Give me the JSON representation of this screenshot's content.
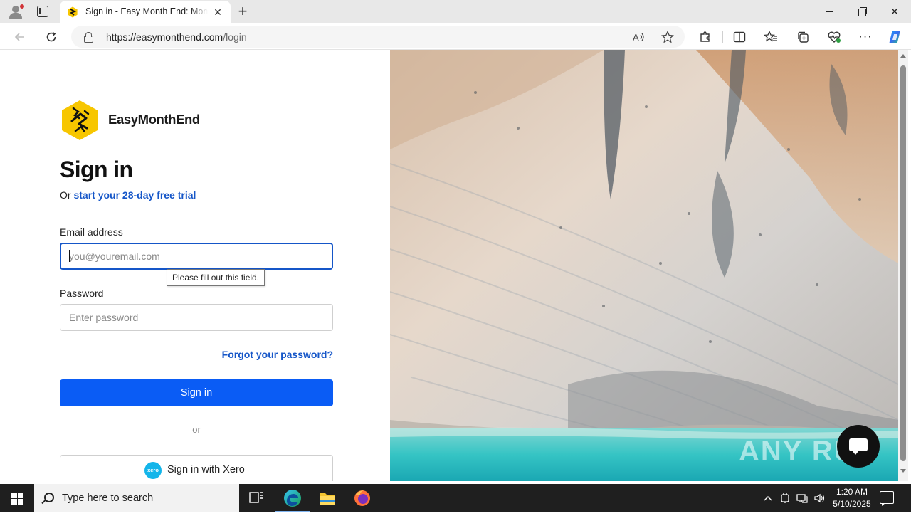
{
  "browser": {
    "tab": {
      "title": "Sign in - Easy Month End: Month End Close Software"
    },
    "address": {
      "host": "https://easymonthend.com",
      "path": "/login"
    }
  },
  "login": {
    "brand": "EasyMonthEnd",
    "heading": "Sign in",
    "subline_prefix": "Or ",
    "trial_link": "start your 28-day free trial",
    "email_label": "Email address",
    "email_placeholder": "you@youremail.com",
    "email_value": "",
    "validation_tooltip": "Please fill out this field.",
    "password_label": "Password",
    "password_placeholder": "Enter password",
    "forgot_link": "Forgot your password?",
    "signin_button": "Sign in",
    "divider_text": "or",
    "xero_logo": "xero",
    "xero_button": "Sign in with Xero"
  },
  "watermark": "ANY RUN",
  "taskbar": {
    "search_placeholder": "Type here to search",
    "time": "1:20 AM",
    "date": "5/10/2025"
  },
  "colors": {
    "accent": "#0a5cf5",
    "link": "#1556c8",
    "logo_yellow": "#f7c600",
    "xero": "#13b5ea"
  },
  "icons": {
    "tab_favicon": "easymonthend-logo-icon",
    "back": "back-arrow-icon",
    "refresh": "refresh-icon",
    "read_aloud": "read-aloud-icon",
    "favorite": "star-icon",
    "extensions": "puzzle-icon",
    "split_screen": "split-screen-icon",
    "favorites": "favorites-icon",
    "collections": "collections-icon",
    "performance": "heart-pulse-icon",
    "menu": "more-icon",
    "copilot": "copilot-icon"
  }
}
